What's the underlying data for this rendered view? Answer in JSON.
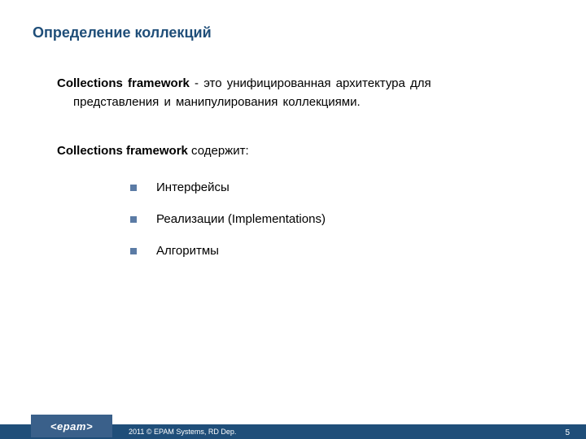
{
  "title": "Определение коллекций",
  "paragraph1": {
    "bold": "Collections framework",
    "rest_line1": " - это унифицированная архитектура для",
    "line2": "представления и манипулирования коллекциями."
  },
  "paragraph2": {
    "bold": "Collections framework",
    "rest": " содержит:"
  },
  "bullets": [
    "Интерфейсы",
    "Реализации (Implementations)",
    "Алгоритмы"
  ],
  "footer": {
    "logo": "<epam>",
    "copyright": "2011 © EPAM Systems, RD Dep.",
    "page": "5"
  }
}
